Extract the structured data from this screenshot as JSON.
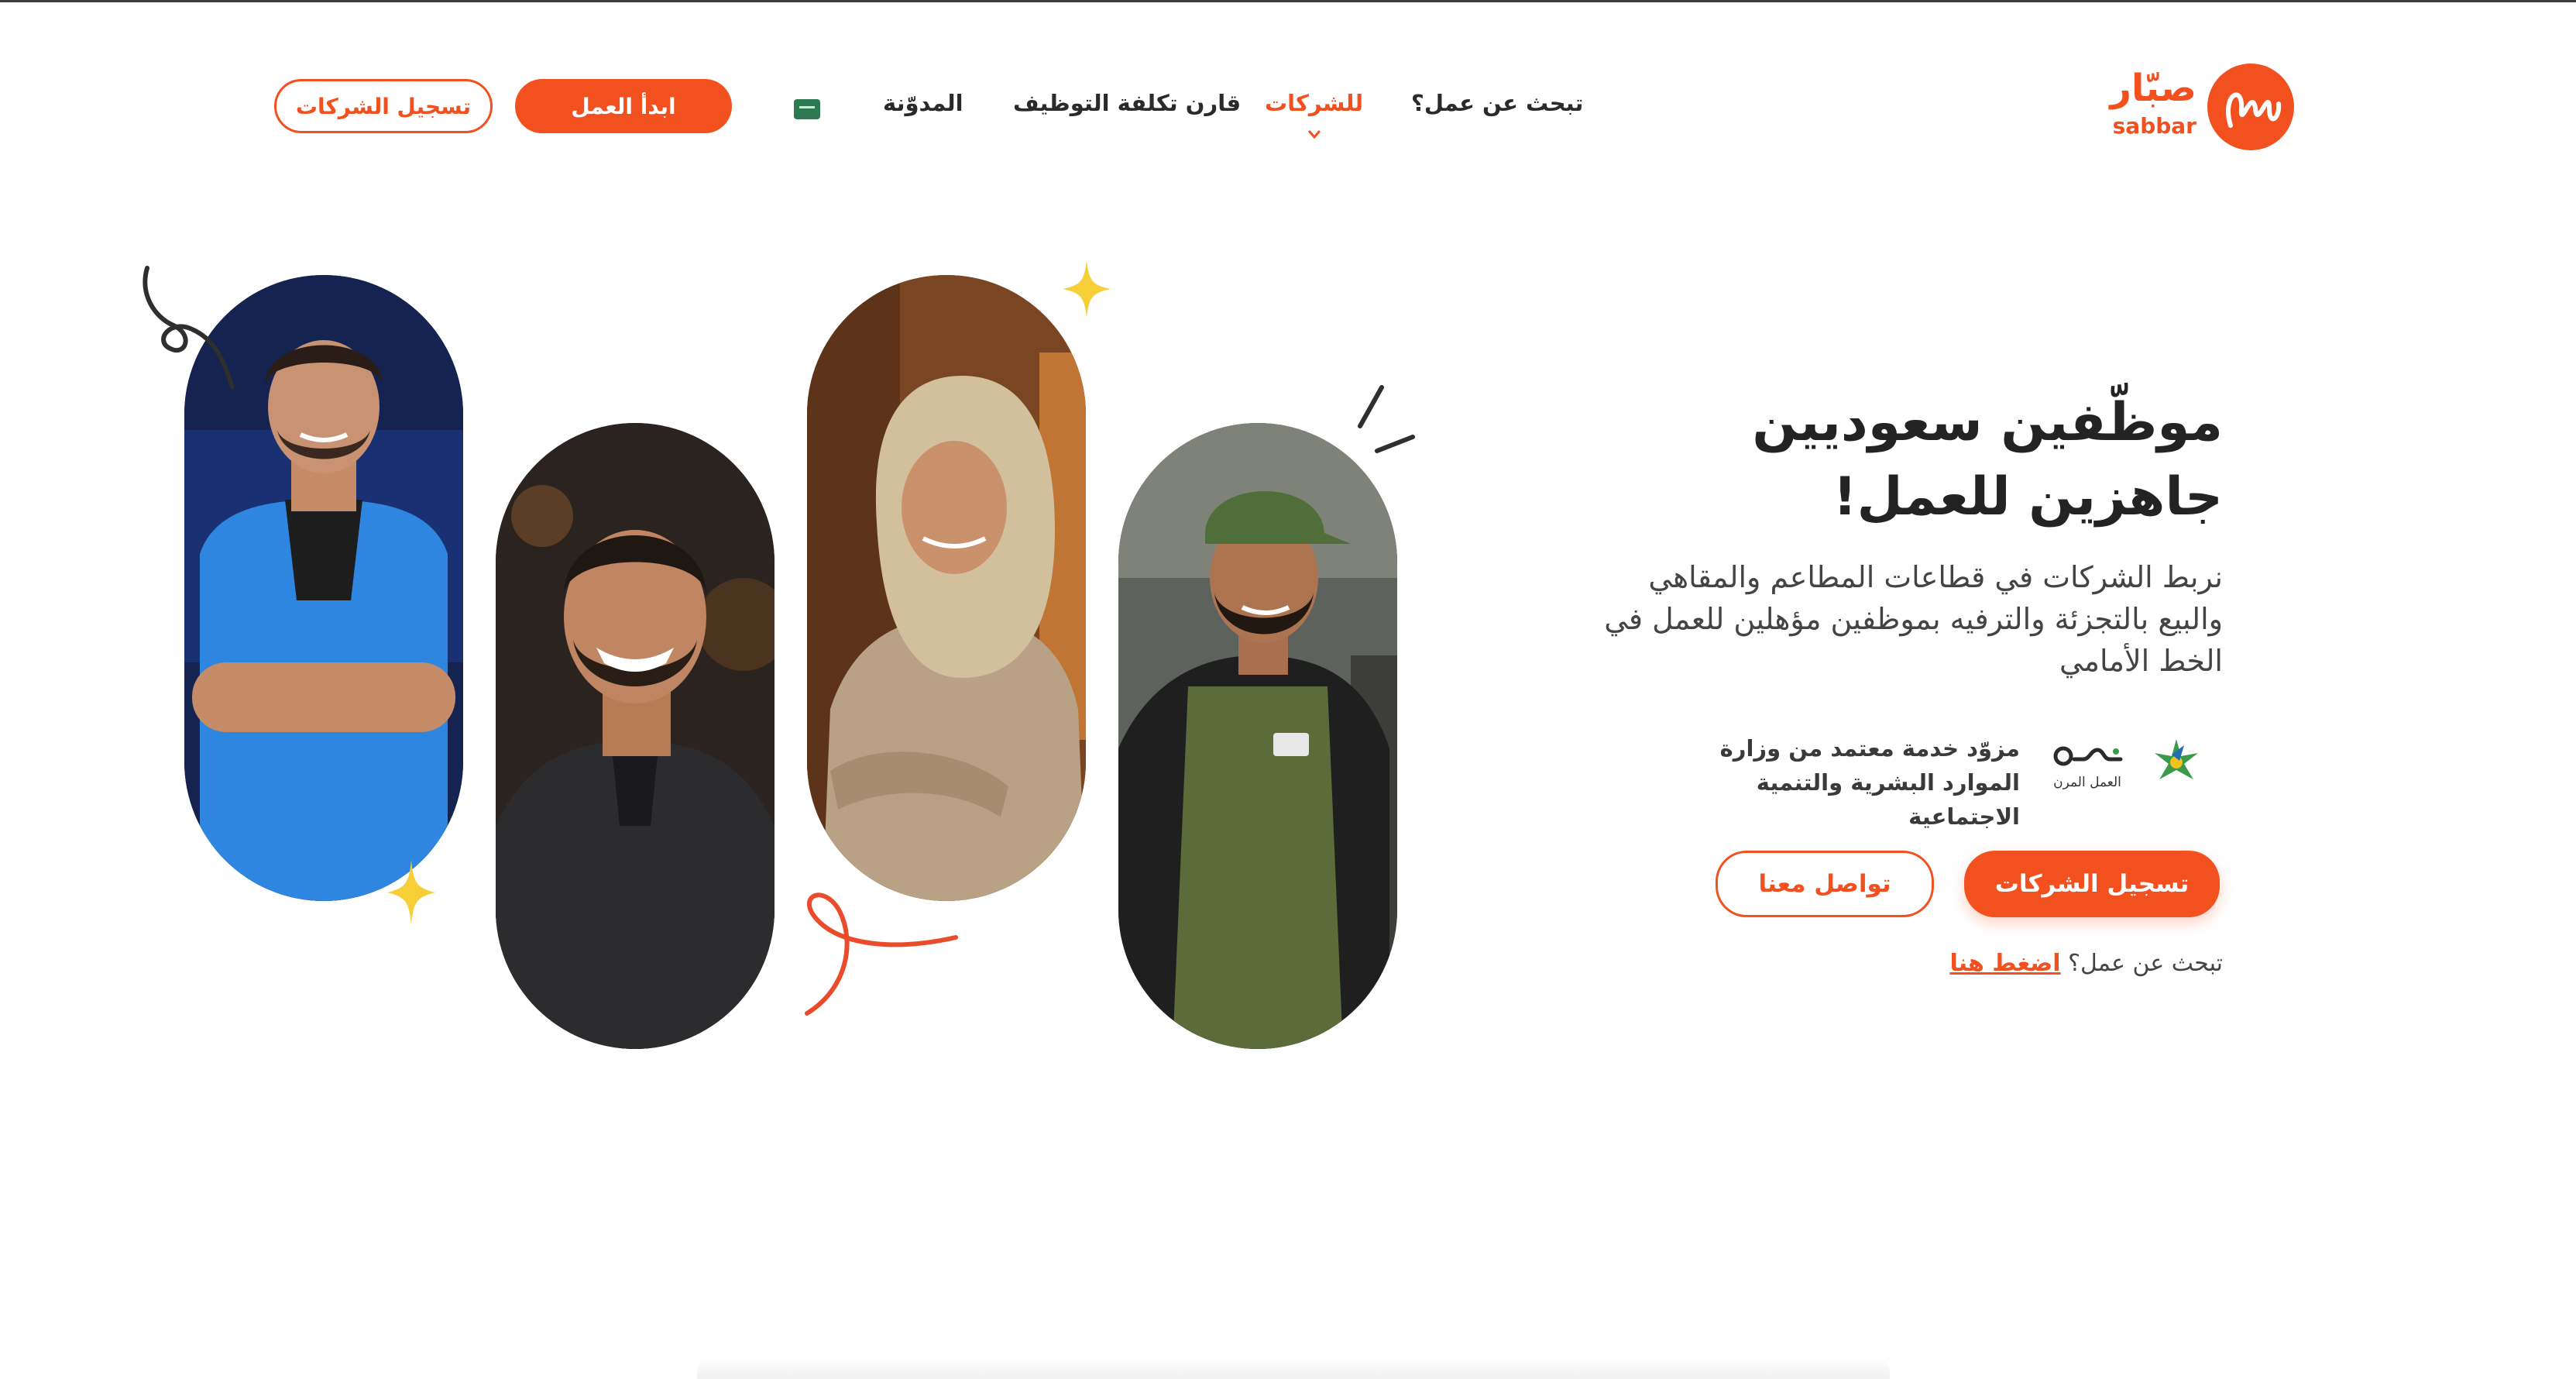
{
  "brand": {
    "name_ar": "صبّار",
    "name_en": "sabbar",
    "primary_color": "#f2501e"
  },
  "nav": {
    "find_job": "تبحث عن عمل؟",
    "companies": "للشركات",
    "compare_cost": "قارن تكلفة التوظيف",
    "blog": "المدوّنة",
    "language_icon": "flag-icon",
    "start_work": "ابدأ العمل",
    "register_companies": "تسجيل الشركات"
  },
  "hero": {
    "title_line1": "موظّفين سعوديين",
    "title_line2": "جاهزين للعمل!",
    "description": "نربط الشركات في قطاعات المطاعم والمقاهي والبيع بالتجزئة والترفيه بموظفين مؤهلين للعمل في الخط الأمامي",
    "accreditation": "مزوّد خدمة معتمد من وزارة الموارد البشرية والتنمية الاجتماعية",
    "partner_logo_text": "العمل المرن",
    "primary_cta": "تسجيل الشركات",
    "secondary_cta": "تواصل معنا",
    "job_seek_question": "تبحث عن عمل؟",
    "job_seek_link": "اضغط هنا"
  },
  "photos": [
    {
      "name": "photo-worker-blue-vest"
    },
    {
      "name": "photo-worker-black-polo"
    },
    {
      "name": "photo-worker-headscarf"
    },
    {
      "name": "photo-worker-green-apron"
    }
  ]
}
